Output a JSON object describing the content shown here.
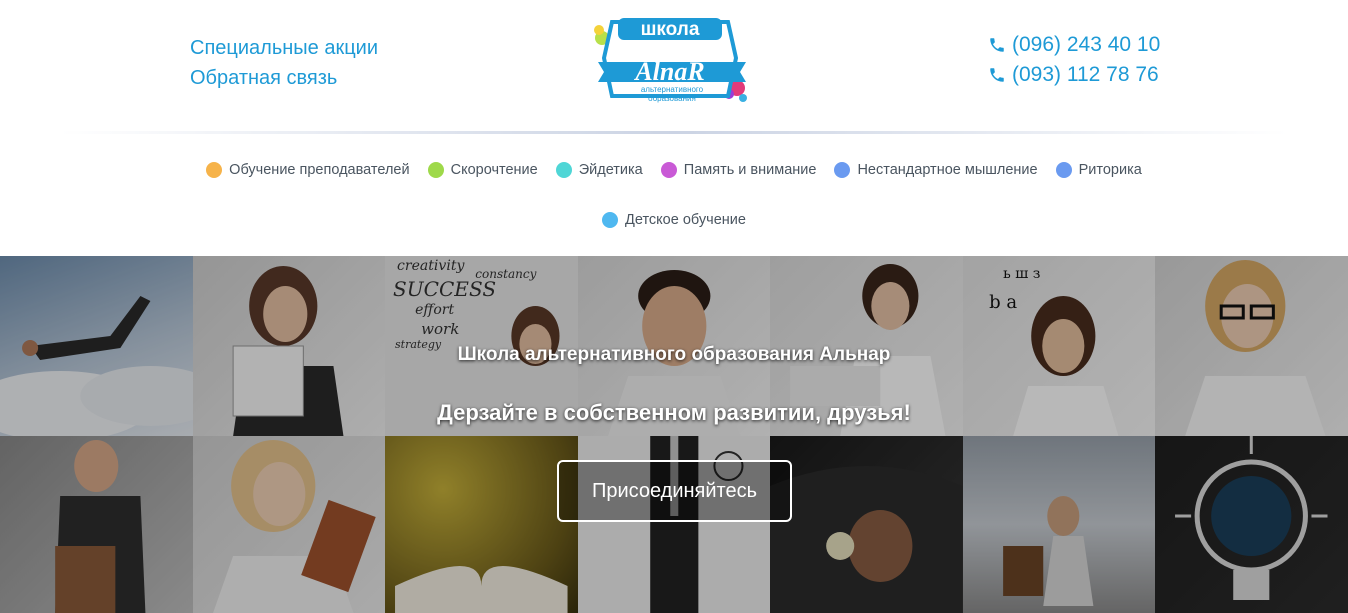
{
  "header": {
    "links": [
      "Специальные акции",
      "Обратная связь"
    ],
    "logo": {
      "top_text": "школа",
      "brand": "AlnaR",
      "tagline_1": "альтернативного",
      "tagline_2": "образования"
    },
    "phones": [
      "(096) 243 40 10",
      "(093) 112 78 76"
    ],
    "phone_icon": "phone-icon"
  },
  "nav": {
    "row1": [
      {
        "label": "Обучение преподавателей",
        "color": "#f6b34a"
      },
      {
        "label": "Скорочтение",
        "color": "#9ed94a"
      },
      {
        "label": "Эйдетика",
        "color": "#4fd6d6"
      },
      {
        "label": "Память и внимание",
        "color": "#c95ad6"
      },
      {
        "label": "Нестандартное мышление",
        "color": "#6a9af0"
      },
      {
        "label": "Риторика",
        "color": "#6a9af0"
      }
    ],
    "row2": [
      {
        "label": "Детское обучение",
        "color": "#4fb8f0"
      }
    ]
  },
  "hero": {
    "subtitle": "Школа альтернативного образования Альнар",
    "title": "Дерзайте в собственном развитии, друзья!",
    "cta_label": "Присоединяйтесь",
    "board_words": [
      "creativity",
      "constancy",
      "SUCCESS",
      "effort",
      "work",
      "strategy"
    ]
  },
  "colors": {
    "accent": "#1e9ad6",
    "nav_text": "#4a5560"
  }
}
